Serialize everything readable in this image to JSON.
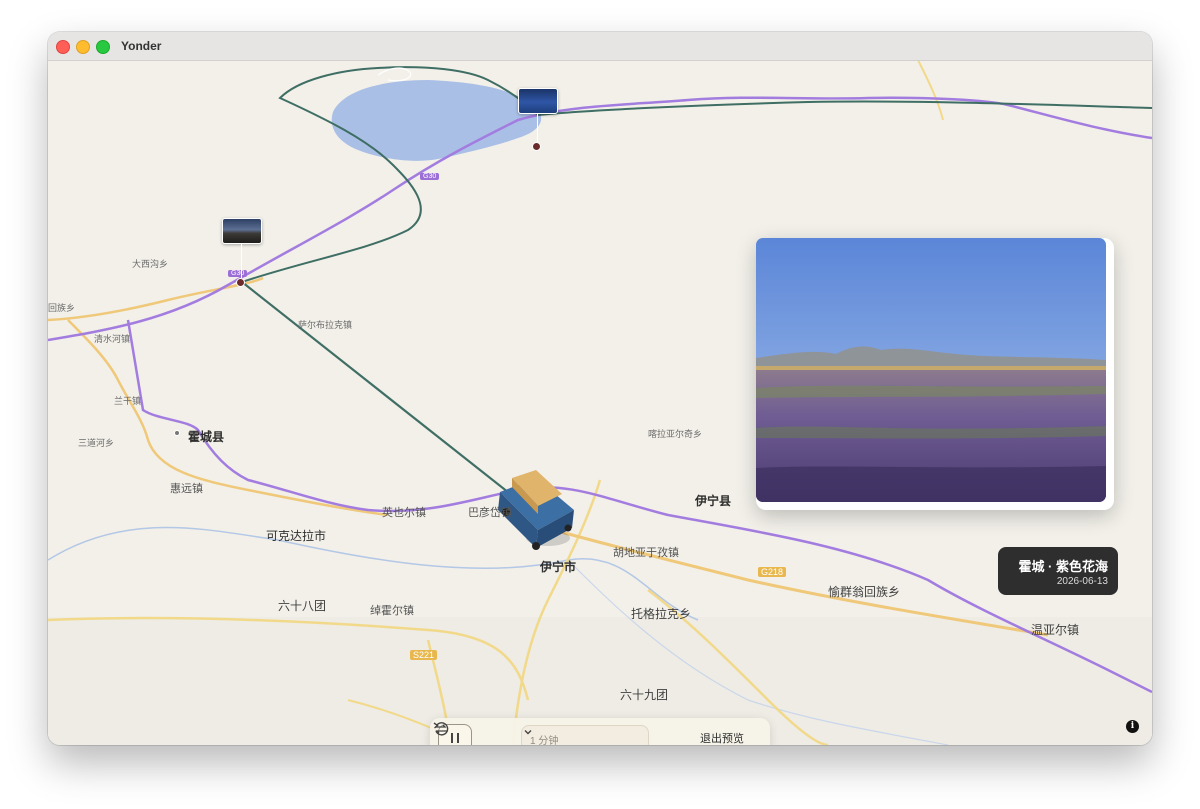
{
  "window": {
    "title": "Yonder"
  },
  "map": {
    "labels": {
      "huocheng": "霍城县",
      "yining_city": "伊宁市",
      "yining_county": "伊宁县",
      "kekedala": "可克达拉市",
      "huiyuan": "惠远镇",
      "sandaohe": "三道河乡",
      "sanshi": "兰干镇",
      "qingshuihe": "清水河镇",
      "yuqunweng": "愉群翁回族乡",
      "hudiyayu": "胡地亚于孜镇",
      "tuogelake": "托格拉克乡",
      "wenyaer": "温亚尔镇",
      "liushiba": "六十八团",
      "liushijiu": "六十九团",
      "huoerzhen": "绰霍尔镇",
      "yingye": "英也尔镇",
      "bayan": "巴彦岱镇",
      "saerbu": "萨尔布拉克镇",
      "kalayaer": "喀拉亚尔奇乡",
      "daxigou": "大西沟乡",
      "huihuizu": "回族乡"
    },
    "routes": {
      "g218": "G218",
      "s221": "S221",
      "g30_a": "G30",
      "g30_b": "G30"
    }
  },
  "photo": {
    "title": "霍城 · 紫色花海",
    "date": "2026-06-13"
  },
  "controls": {
    "duration": "1 分钟",
    "exit_label": "退出预览"
  },
  "info_icon": "i"
}
